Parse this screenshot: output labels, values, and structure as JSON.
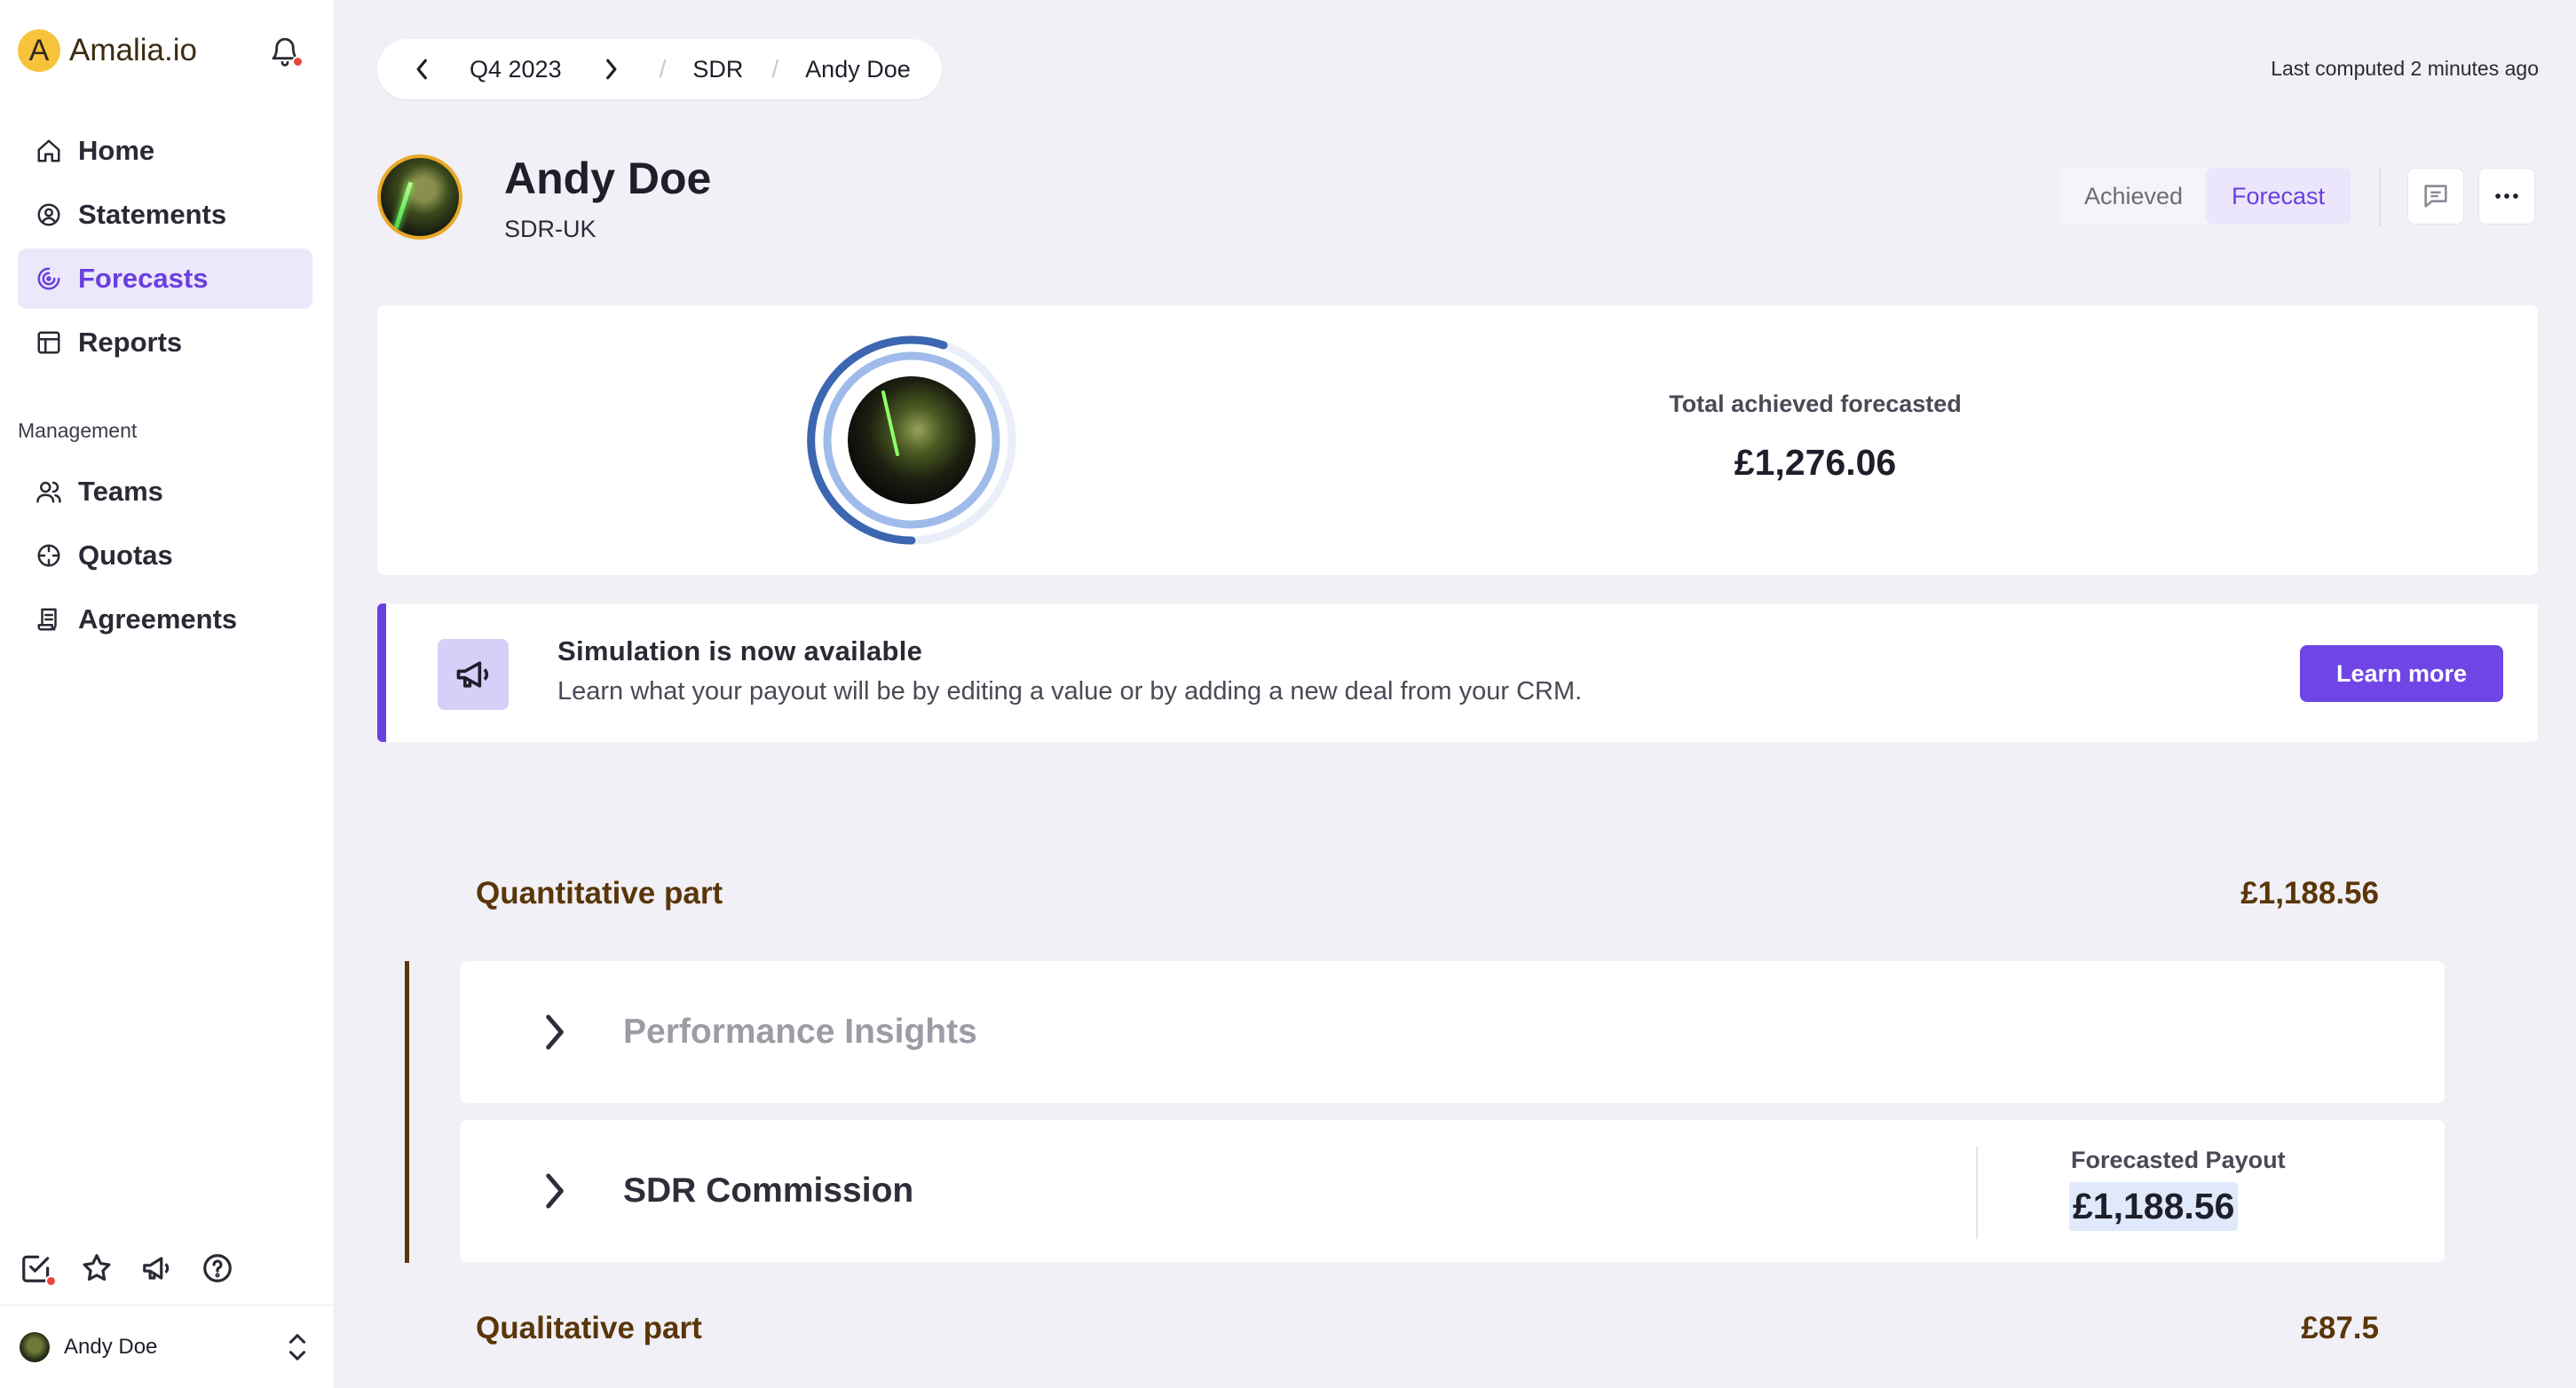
{
  "app": {
    "brand_letter": "A",
    "brand_name": "Amalia.io"
  },
  "sidebar": {
    "nav": [
      {
        "label": "Home",
        "icon": "home-icon"
      },
      {
        "label": "Statements",
        "icon": "user-circle-icon"
      },
      {
        "label": "Forecasts",
        "icon": "forecast-icon",
        "active": true
      },
      {
        "label": "Reports",
        "icon": "table-icon"
      }
    ],
    "management_label": "Management",
    "management": [
      {
        "label": "Teams",
        "icon": "users-icon"
      },
      {
        "label": "Quotas",
        "icon": "target-icon"
      },
      {
        "label": "Agreements",
        "icon": "document-icon"
      }
    ],
    "user_name": "Andy Doe"
  },
  "breadcrumb": {
    "period": "Q4 2023",
    "team": "SDR",
    "person": "Andy Doe"
  },
  "last_computed": "Last computed 2 minutes ago",
  "profile": {
    "name": "Andy Doe",
    "team": "SDR-UK"
  },
  "toggle": {
    "achieved": "Achieved",
    "forecast": "Forecast",
    "selected": "Forecast"
  },
  "summary": {
    "label": "Total achieved forecasted",
    "value": "£1,276.06"
  },
  "banner": {
    "title": "Simulation is now available",
    "text": "Learn what your payout will be by editing a value or by adding a new deal from your CRM.",
    "button": "Learn more"
  },
  "quantitative": {
    "title": "Quantitative part",
    "value": "£1,188.56",
    "rules": [
      {
        "name": "Performance Insights"
      },
      {
        "name": "SDR Commission",
        "payout_label": "Forecasted Payout",
        "payout_value": "£1,188.56"
      }
    ]
  },
  "qualitative": {
    "title": "Qualitative part",
    "value": "£87.5"
  },
  "colors": {
    "accent": "#6a3fe0",
    "section": "#5a3608",
    "brand_logo": "#f6c33a"
  }
}
